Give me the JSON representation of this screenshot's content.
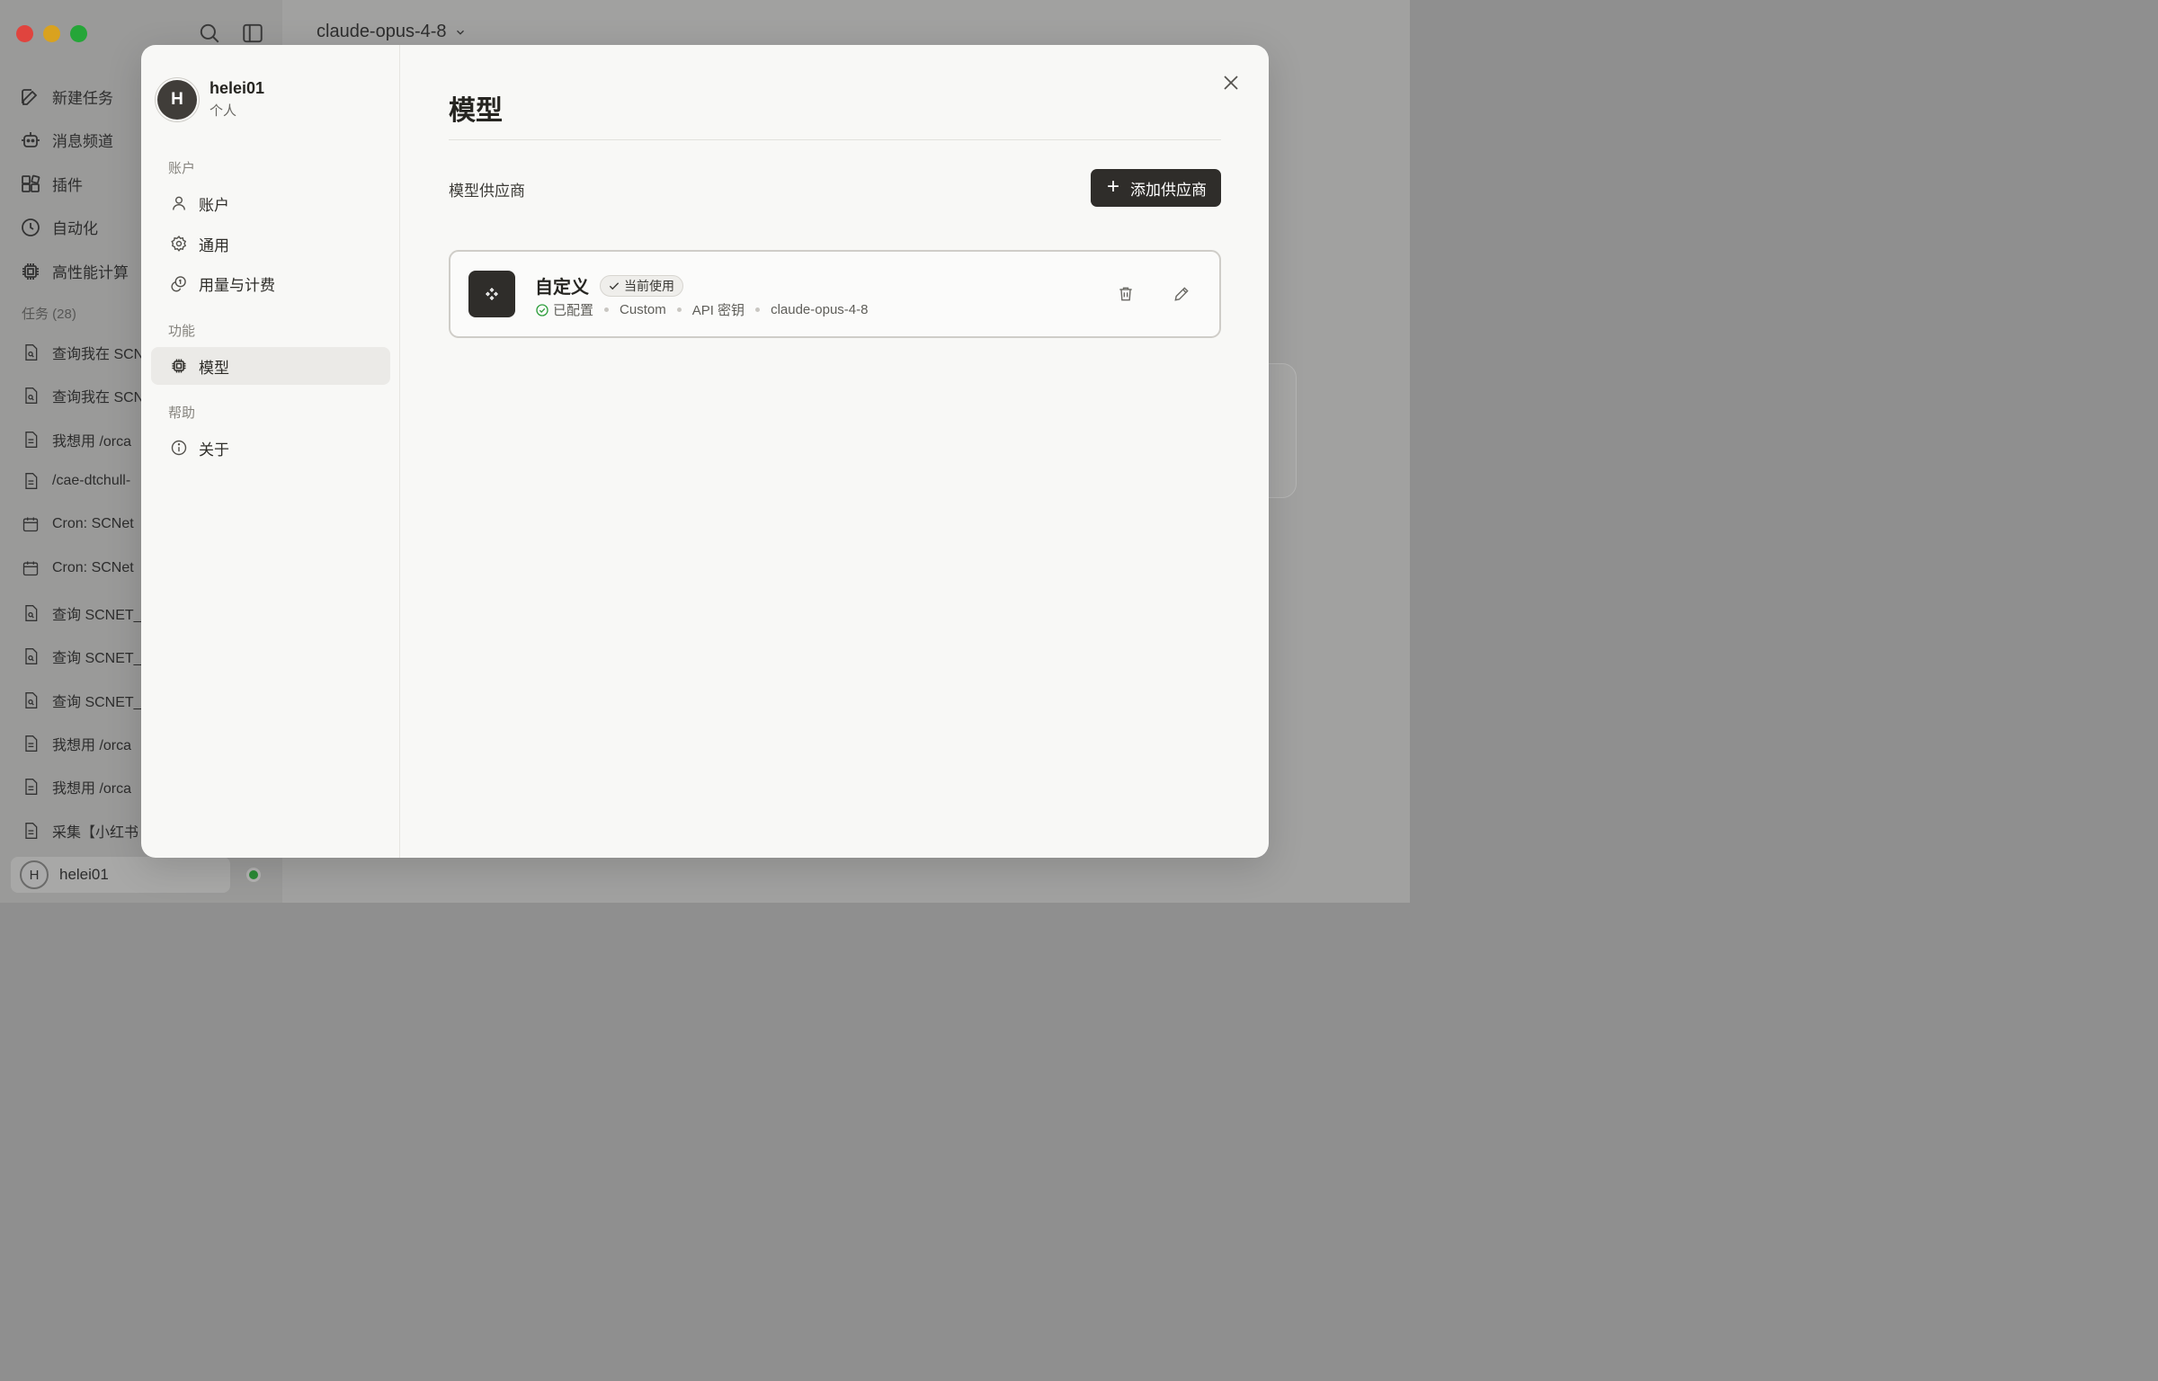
{
  "app": {
    "model_selector": "claude-opus-4-8",
    "nav": [
      {
        "label": "新建任务",
        "icon": "edit-icon"
      },
      {
        "label": "消息频道",
        "icon": "bot-icon"
      },
      {
        "label": "插件",
        "icon": "plugin-icon"
      },
      {
        "label": "自动化",
        "icon": "clock-icon"
      },
      {
        "label": "高性能计算",
        "icon": "chip-icon"
      }
    ],
    "tasks_header": "任务 (28)",
    "tasks": [
      {
        "label": "查询我在 SCNet",
        "icon": "search-doc-icon"
      },
      {
        "label": "查询我在 SCNet",
        "icon": "search-doc-icon"
      },
      {
        "label": "我想用 /orca",
        "icon": "doc-icon"
      },
      {
        "label": "/cae-dtchull-",
        "icon": "doc-icon"
      },
      {
        "label": "Cron: SCNet",
        "icon": "calendar-icon"
      },
      {
        "label": "Cron: SCNet",
        "icon": "calendar-icon"
      },
      {
        "label": "查询 SCNET_",
        "icon": "search-doc-icon"
      },
      {
        "label": "查询 SCNET_",
        "icon": "search-doc-icon"
      },
      {
        "label": "查询 SCNET_",
        "icon": "search-doc-icon"
      },
      {
        "label": "我想用 /orca",
        "icon": "doc-icon"
      },
      {
        "label": "我想用 /orca",
        "icon": "doc-icon"
      },
      {
        "label": "采集【小红书",
        "icon": "doc-icon"
      }
    ],
    "user": {
      "initial": "H",
      "name": "helei01",
      "status_color": "#2a8a36"
    }
  },
  "settings": {
    "profile": {
      "initial": "H",
      "name": "helei01",
      "subtitle": "个人"
    },
    "sections": {
      "account": "账户",
      "features": "功能",
      "help": "帮助"
    },
    "menu": {
      "account": "账户",
      "general": "通用",
      "usage": "用量与计费",
      "models": "模型",
      "about": "关于"
    },
    "active_item": "models",
    "page_title": "模型",
    "providers_label": "模型供应商",
    "add_provider_label": "添加供应商",
    "provider": {
      "name": "自定义",
      "badge": "当前使用",
      "status": "已配置",
      "type": "Custom",
      "auth": "API 密钥",
      "model": "claude-opus-4-8"
    }
  },
  "colors": {
    "accent_dark": "#2f2d2a",
    "success": "#2e9e3c",
    "modal_bg": "#f8f8f6"
  }
}
